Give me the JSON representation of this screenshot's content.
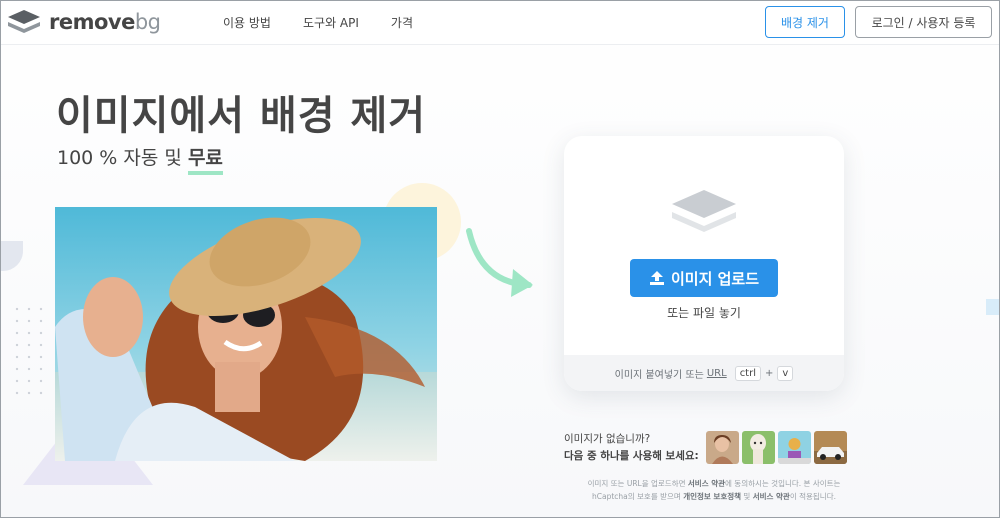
{
  "brand": {
    "logo_text_main": "remove",
    "logo_text_bg": "bg",
    "accent": "#2a91e8",
    "highlight": "#9ee6c5"
  },
  "nav": {
    "items": [
      {
        "label": "이용 방법"
      },
      {
        "label": "도구와 API"
      },
      {
        "label": "가격"
      }
    ],
    "remove_bg_button": "배경 제거",
    "login_button": "로그인 / 사용자 등록"
  },
  "hero": {
    "title": "이미지에서 배경 제거",
    "subtitle_prefix": "100 % 자동 및",
    "subtitle_highlight": "무료"
  },
  "upload": {
    "button_label": "이미지 업로드",
    "drop_text": "또는 파일 놓기",
    "paste_text": "이미지 붙여넣기 또는",
    "paste_url": "URL",
    "kbd_ctrl": "ctrl",
    "kbd_plus": "+",
    "kbd_v": "v"
  },
  "samples": {
    "line1": "이미지가 없습니까?",
    "line2": "다음 중 하나를 사용해 보세요:"
  },
  "disclaimer": {
    "part1": "이미지 또는 URL을 업로드하면",
    "terms1": "서비스 약관",
    "part2": "에 동의하시는 것입니다. 본 사이트는 hCaptcha의 보호를 받으며",
    "privacy": "개인정보 보호정책",
    "part3": "및",
    "terms2": "서비스 약관",
    "part4": "이 적용됩니다."
  },
  "icons": {
    "logo": "removebg-logo-icon",
    "upload": "upload-icon",
    "layers": "layers-icon",
    "arrow": "curved-arrow-icon"
  }
}
